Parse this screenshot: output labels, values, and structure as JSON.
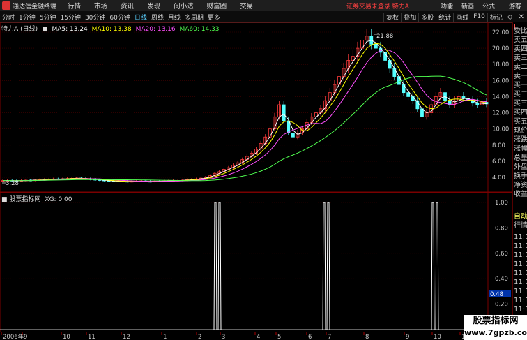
{
  "titlebar": {
    "app_name": "通达信金融终端",
    "menus": [
      "行情",
      "市场",
      "资讯",
      "发现",
      "问小达",
      "财富圈",
      "交易"
    ],
    "warning": "证券交易未登录",
    "stock": "特力A",
    "right_menus": [
      "功能",
      "新画",
      "公式"
    ],
    "guest": "游客"
  },
  "toolbar": {
    "periods": [
      "分时",
      "1分钟",
      "5分钟",
      "15分钟",
      "30分钟",
      "60分钟",
      "日线",
      "周线",
      "月线",
      "多周期",
      "更多"
    ],
    "active_period": "日线",
    "right_buttons": [
      "复权",
      "叠加",
      "多股",
      "统计",
      "画线",
      "F10",
      "标记"
    ],
    "window_buttons": [
      "◇",
      "✕"
    ]
  },
  "main_legend": {
    "title": "特力A",
    "period": "(日线)",
    "ma": [
      {
        "label": "MA5: 13.24",
        "color": "#ffffff"
      },
      {
        "label": "MA10: 13.38",
        "color": "#ffff00"
      },
      {
        "label": "MA20: 13.16",
        "color": "#ff50ff"
      },
      {
        "label": "MA60: 14.33",
        "color": "#50ff50"
      }
    ]
  },
  "indicator_legend": {
    "title": "股票指标网",
    "value": "XG: 0.00"
  },
  "annotations": {
    "high": "21.88",
    "low": "3.28"
  },
  "chart_data": {
    "type": "line",
    "price_axis": [
      "22.00",
      "20.00",
      "18.00",
      "16.00",
      "14.00",
      "12.00",
      "10.00",
      "8.00",
      "6.00",
      "4.00"
    ],
    "indicator_axis": [
      "1.00",
      "0.80",
      "0.60",
      "0.40",
      "0.20"
    ],
    "indicator_current": "0.48",
    "x_ticks": [
      "2006年",
      "9",
      "10",
      "11",
      "12",
      "1",
      "2",
      "3",
      "4",
      "5",
      "6",
      "7",
      "8",
      "9",
      "10",
      "11",
      "12"
    ],
    "indicator_signals_x": [
      312,
      468,
      624
    ],
    "close": [
      3.6,
      3.62,
      3.58,
      3.55,
      3.6,
      3.65,
      3.62,
      3.68,
      3.7,
      3.72,
      3.75,
      3.8,
      3.78,
      3.82,
      3.85,
      3.88,
      3.9,
      3.86,
      3.8,
      3.75,
      3.7,
      3.65,
      3.6,
      3.55,
      3.5,
      3.52,
      3.5,
      3.48,
      3.5,
      3.52,
      3.55,
      3.5,
      3.48,
      3.52,
      3.5,
      3.55,
      3.58,
      3.6,
      3.62,
      3.65,
      3.7,
      3.75,
      3.8,
      3.9,
      4.0,
      4.2,
      4.5,
      4.7,
      5.0,
      5.2,
      5.5,
      5.8,
      6.2,
      6.6,
      7.0,
      7.5,
      8.2,
      9.0,
      10.0,
      11.5,
      13.0,
      11.0,
      9.5,
      9.0,
      9.5,
      10.0,
      10.8,
      11.5,
      12.0,
      12.5,
      13.5,
      14.5,
      15.5,
      16.5,
      17.5,
      18.5,
      19.0,
      20.0,
      21.0,
      21.5,
      20.5,
      20.0,
      19.5,
      18.5,
      17.5,
      16.5,
      15.5,
      14.5,
      14.0,
      13.5,
      12.5,
      11.5,
      12.0,
      13.0,
      14.0,
      14.5,
      13.5,
      13.0,
      13.5,
      14.0,
      13.8,
      13.5,
      13.2,
      13.0,
      13.3,
      13.1
    ]
  }
}
